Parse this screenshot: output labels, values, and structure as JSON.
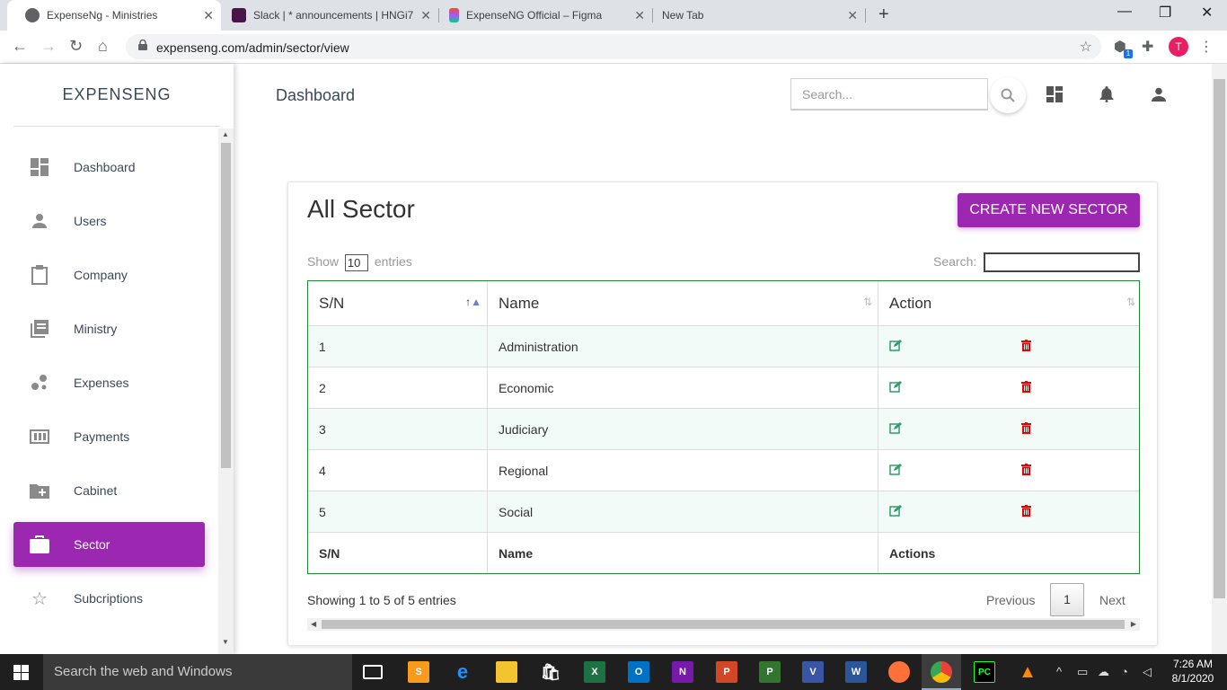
{
  "browser": {
    "tabs": [
      {
        "title": "ExpenseNg - Ministries",
        "active": true
      },
      {
        "title": "Slack | * announcements | HNGi7"
      },
      {
        "title": "ExpenseNG Official – Figma"
      },
      {
        "title": "New Tab"
      }
    ],
    "url": "expenseng.com/admin/sector/view",
    "profile_initial": "T",
    "extension_badge": "1"
  },
  "sidebar": {
    "brand": "EXPENSENG",
    "items": [
      {
        "label": "Dashboard",
        "icon": "dashboard-icon"
      },
      {
        "label": "Users",
        "icon": "person-icon"
      },
      {
        "label": "Company",
        "icon": "clipboard-icon"
      },
      {
        "label": "Ministry",
        "icon": "library-books-icon"
      },
      {
        "label": "Expenses",
        "icon": "bubble-chart-icon"
      },
      {
        "label": "Payments",
        "icon": "money-icon"
      },
      {
        "label": "Cabinet",
        "icon": "create-folder-icon"
      },
      {
        "label": "Sector",
        "icon": "briefcase-icon",
        "active": true
      },
      {
        "label": "Subcriptions",
        "icon": "star-icon"
      }
    ],
    "active_color": "#9c27b0"
  },
  "header": {
    "title": "Dashboard",
    "search_placeholder": "Search..."
  },
  "main": {
    "title": "All Sector",
    "create_button": "CREATE NEW SECTOR",
    "show_label": "Show",
    "show_value": "10",
    "entries_label": "entries",
    "search_label": "Search:",
    "columns": [
      "S/N",
      "Name",
      "Action"
    ],
    "rows": [
      {
        "sn": "1",
        "name": "Administration"
      },
      {
        "sn": "2",
        "name": "Economic"
      },
      {
        "sn": "3",
        "name": "Judiciary"
      },
      {
        "sn": "4",
        "name": "Regional"
      },
      {
        "sn": "5",
        "name": "Social"
      }
    ],
    "footer_columns": [
      "S/N",
      "Name",
      "Actions"
    ],
    "info": "Showing 1 to 5 of 5 entries",
    "pagination": {
      "previous": "Previous",
      "current": "1",
      "next": "Next"
    }
  },
  "taskbar": {
    "search_placeholder": "Search the web and Windows",
    "time": "7:26 AM",
    "date": "8/1/2020"
  }
}
